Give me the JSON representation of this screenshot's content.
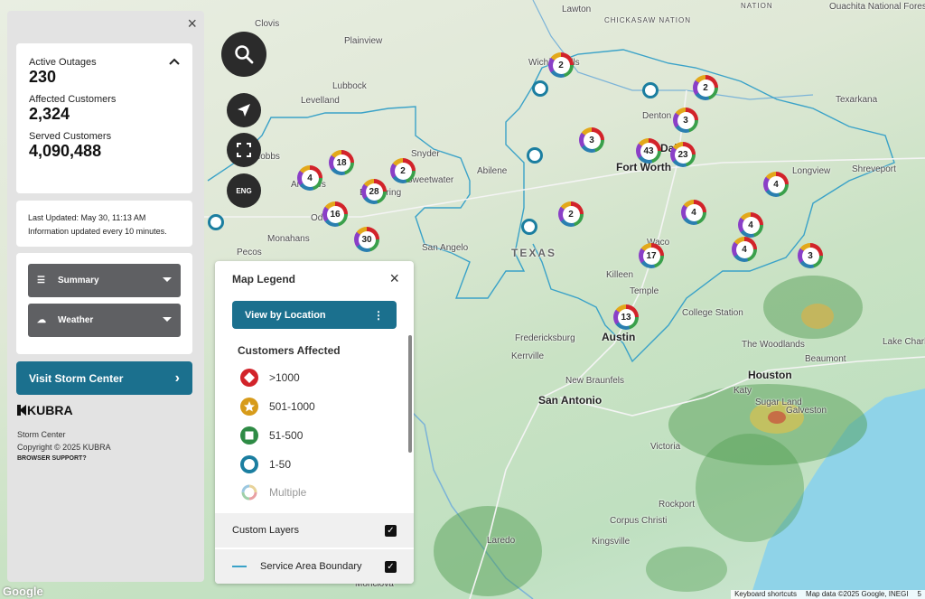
{
  "places": [
    {
      "name": "Clovis",
      "cls": "place"
    },
    {
      "name": "Plainview",
      "cls": "place"
    },
    {
      "name": "Lubbock",
      "cls": "place"
    },
    {
      "name": "Levelland",
      "cls": "place"
    },
    {
      "name": "Snyder",
      "cls": "place"
    },
    {
      "name": "Hobbs",
      "cls": "place"
    },
    {
      "name": "Andrews",
      "cls": "place"
    },
    {
      "name": "Big Spring",
      "cls": "place"
    },
    {
      "name": "Sweetwater",
      "cls": "place"
    },
    {
      "name": "Abilene",
      "cls": "place"
    },
    {
      "name": "Odessa",
      "cls": "place"
    },
    {
      "name": "Monahans",
      "cls": "place"
    },
    {
      "name": "Pecos",
      "cls": "place"
    },
    {
      "name": "San Angelo",
      "cls": "place"
    },
    {
      "name": "TEXAS",
      "cls": "place state"
    },
    {
      "name": "Lawton",
      "cls": "place"
    },
    {
      "name": "Wichita Falls",
      "cls": "place"
    },
    {
      "name": "CHICKASAW NATION",
      "cls": "place"
    },
    {
      "name": "Texarkana",
      "cls": "place"
    },
    {
      "name": "Denton",
      "cls": "place"
    },
    {
      "name": "Dallas",
      "cls": "place city"
    },
    {
      "name": "Fort Worth",
      "cls": "place city"
    },
    {
      "name": "Longview",
      "cls": "place"
    },
    {
      "name": "Shreveport",
      "cls": "place"
    },
    {
      "name": "Waco",
      "cls": "place"
    },
    {
      "name": "Killeen",
      "cls": "place"
    },
    {
      "name": "Temple",
      "cls": "place"
    },
    {
      "name": "College Station",
      "cls": "place"
    },
    {
      "name": "Austin",
      "cls": "place city"
    },
    {
      "name": "Fredericksburg",
      "cls": "place"
    },
    {
      "name": "Kerrville",
      "cls": "place"
    },
    {
      "name": "New Braunfels",
      "cls": "place"
    },
    {
      "name": "San Antonio",
      "cls": "place city"
    },
    {
      "name": "The Woodlands",
      "cls": "place"
    },
    {
      "name": "Houston",
      "cls": "place city"
    },
    {
      "name": "Beaumont",
      "cls": "place"
    },
    {
      "name": "Lake Charle",
      "cls": "place"
    },
    {
      "name": "Sugar Land",
      "cls": "place"
    },
    {
      "name": "Katy",
      "cls": "place"
    },
    {
      "name": "Galveston",
      "cls": "place"
    },
    {
      "name": "Victoria",
      "cls": "place"
    },
    {
      "name": "Rockport",
      "cls": "place"
    },
    {
      "name": "Corpus Christi",
      "cls": "place"
    },
    {
      "name": "Kingsville",
      "cls": "place"
    },
    {
      "name": "Laredo",
      "cls": "place"
    },
    {
      "name": "Monclova",
      "cls": "place"
    },
    {
      "name": "Ouachita National Forest",
      "cls": "place"
    },
    {
      "name": "NATION",
      "cls": "place"
    }
  ],
  "clusters": [
    "2",
    "2",
    "2",
    "18",
    "4",
    "28",
    "16",
    "30",
    "3",
    "43",
    "23",
    "3",
    "4",
    "2",
    "4",
    "4",
    "4",
    "17",
    "3",
    "13"
  ],
  "rings": 5,
  "panel": {
    "active_outages_label": "Active Outages",
    "active_outages": "230",
    "affected_customers_label": "Affected Customers",
    "affected_customers": "2,324",
    "served_customers_label": "Served Customers",
    "served_customers": "4,090,488",
    "last_updated": "Last Updated: May 30, 11:13 AM",
    "update_note": "Information updated every 10 minutes.",
    "summary_label": "Summary",
    "weather_label": "Weather",
    "storm_center_button": "Visit Storm Center",
    "brand_name": "KUBRA",
    "footer_title": "Storm Center",
    "copyright": "Copyright © 2025 KUBRA",
    "browser_support": "BROWSER SUPPORT?"
  },
  "controls": {
    "language": "ENG"
  },
  "legend": {
    "title": "Map Legend",
    "view_button": "View by Location",
    "customers_affected_title": "Customers Affected",
    "items": [
      {
        "label": ">1000",
        "color": "#d2232a",
        "shape": "diamond"
      },
      {
        "label": "501-1000",
        "color": "#d79b1a",
        "shape": "star"
      },
      {
        "label": "51-500",
        "color": "#2e8b45",
        "shape": "square"
      },
      {
        "label": "1-50",
        "color": "#1b7ea0",
        "shape": "ring"
      },
      {
        "label": "Multiple",
        "color": "#999999",
        "shape": "multi"
      }
    ],
    "custom_layers_label": "Custom Layers",
    "service_area_label": "Service Area Boundary"
  },
  "attribution": {
    "google": "Google",
    "shortcuts": "Keyboard shortcuts",
    "map_data": "Map data ©2025 Google, INEGI",
    "scale": "5"
  }
}
